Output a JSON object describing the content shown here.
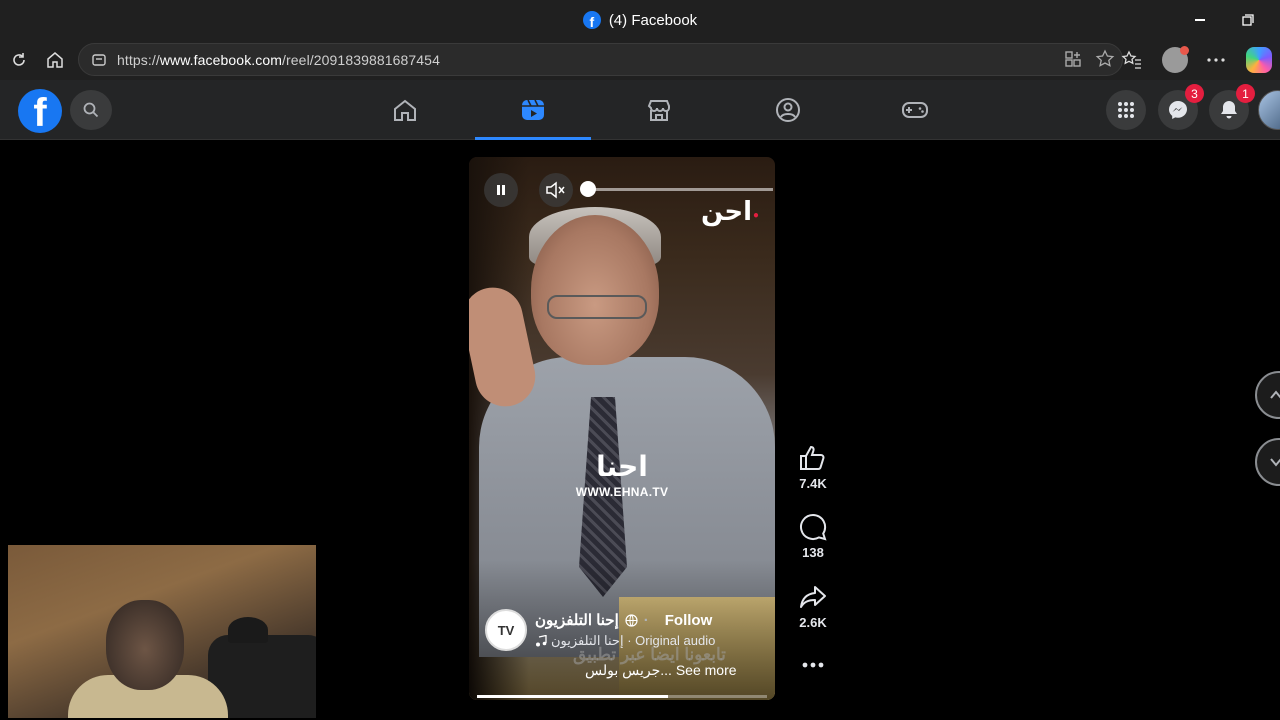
{
  "browser": {
    "tab_title": "(4) Facebook",
    "url_prefix": "https://",
    "url_host": "www.facebook.com",
    "url_path": "/reel/2091839881687454"
  },
  "fbnav": {
    "messenger_badge": "3",
    "notifications_badge": "1",
    "active_tab": "reels",
    "accent_color": "#2d88ff"
  },
  "reel": {
    "watermark_site": "WWW.EHNA.TV",
    "channel_name": "إحنا التلفزيون",
    "follow_label": "Follow",
    "audio_text": "إحنا التلفزيون · Original audio",
    "caption_overlay": "تابعونا ايضا عبر تطبيق",
    "caption_text": "جريس بولس... See more",
    "progress": 0.66
  },
  "actions": {
    "likes": "7.4K",
    "comments": "138",
    "shares": "2.6K"
  }
}
